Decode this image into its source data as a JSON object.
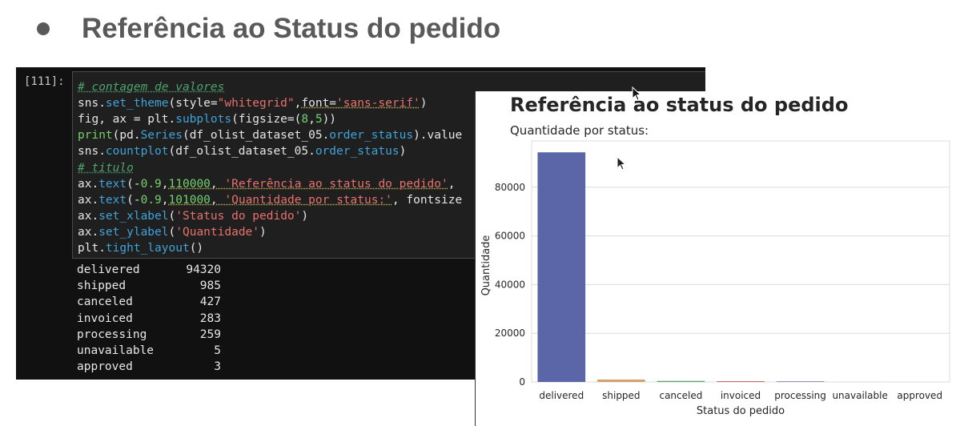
{
  "slide": {
    "title": "Referência ao Status do pedido"
  },
  "notebook": {
    "prompt": "[111]:",
    "code_lines": [
      [
        {
          "t": "# contagem de valores",
          "c": "cm"
        }
      ],
      [
        {
          "t": "sns."
        },
        {
          "t": "set_theme",
          "c": "fn"
        },
        {
          "t": "(style="
        },
        {
          "t": "\"whitegrid\"",
          "c": "st"
        },
        {
          "t": ","
        },
        {
          "t": "font=",
          "c": "ul"
        },
        {
          "t": "'sans-serif'",
          "c": "st ul"
        },
        {
          "t": ")"
        }
      ],
      [
        {
          "t": "fig, ax = plt."
        },
        {
          "t": "subplots",
          "c": "fn"
        },
        {
          "t": "(figsize=("
        },
        {
          "t": "8",
          "c": "nm"
        },
        {
          "t": ","
        },
        {
          "t": "5",
          "c": "nm"
        },
        {
          "t": "))"
        }
      ],
      [
        {
          "t": "print",
          "c": "nm"
        },
        {
          "t": "(pd."
        },
        {
          "t": "Series",
          "c": "fn"
        },
        {
          "t": "(df_olist_dataset_05."
        },
        {
          "t": "order_status",
          "c": "fn"
        },
        {
          "t": ").value"
        }
      ],
      [
        {
          "t": "sns."
        },
        {
          "t": "countplot",
          "c": "fn"
        },
        {
          "t": "(df_olist_dataset_05."
        },
        {
          "t": "order_status",
          "c": "fn"
        },
        {
          "t": ")"
        }
      ],
      [
        {
          "t": "# titulo",
          "c": "cm"
        }
      ],
      [
        {
          "t": "ax."
        },
        {
          "t": "text",
          "c": "fn"
        },
        {
          "t": "(-"
        },
        {
          "t": "0.9",
          "c": "nm"
        },
        {
          "t": ","
        },
        {
          "t": "110000",
          "c": "nm ul"
        },
        {
          "t": ", ",
          "c": "ul"
        },
        {
          "t": "'Referência ao status do pedido'",
          "c": "st ul"
        },
        {
          "t": ", "
        }
      ],
      [
        {
          "t": "ax."
        },
        {
          "t": "text",
          "c": "fn"
        },
        {
          "t": "(-"
        },
        {
          "t": "0.9",
          "c": "nm"
        },
        {
          "t": ","
        },
        {
          "t": "101000",
          "c": "nm ul"
        },
        {
          "t": ", ",
          "c": "ul"
        },
        {
          "t": "'Quantidade por status:'",
          "c": "st ul"
        },
        {
          "t": ", fontsize"
        }
      ],
      [
        {
          "t": "ax."
        },
        {
          "t": "set_xlabel",
          "c": "fn"
        },
        {
          "t": "("
        },
        {
          "t": "'Status do pedido'",
          "c": "st"
        },
        {
          "t": ")"
        }
      ],
      [
        {
          "t": "ax."
        },
        {
          "t": "set_ylabel",
          "c": "fn"
        },
        {
          "t": "("
        },
        {
          "t": "'Quantidade'",
          "c": "st"
        },
        {
          "t": ")"
        }
      ],
      [
        {
          "t": "plt."
        },
        {
          "t": "tight_layout",
          "c": "fn"
        },
        {
          "t": "()"
        }
      ]
    ],
    "output_rows": [
      {
        "label": "delivered",
        "value": "94320"
      },
      {
        "label": "shipped",
        "value": "985"
      },
      {
        "label": "canceled",
        "value": "427"
      },
      {
        "label": "invoiced",
        "value": "283"
      },
      {
        "label": "processing",
        "value": "259"
      },
      {
        "label": "unavailable",
        "value": "5"
      },
      {
        "label": "approved",
        "value": "3"
      }
    ]
  },
  "chart_data": {
    "type": "bar",
    "title": "Referência ao status do pedido",
    "subtitle": "Quantidade por status:",
    "xlabel": "Status do pedido",
    "ylabel": "Quantidade",
    "categories": [
      "delivered",
      "shipped",
      "canceled",
      "invoiced",
      "processing",
      "unavailable",
      "approved"
    ],
    "values": [
      94320,
      985,
      427,
      283,
      259,
      5,
      3
    ],
    "yticks": [
      0,
      20000,
      40000,
      60000,
      80000
    ],
    "ylim": [
      0,
      99000
    ],
    "grid": true,
    "colors": [
      "#5a66a8",
      "#d6a26b",
      "#59a86a",
      "#c44e52",
      "#8172b3",
      "#937860",
      "#da8bc3"
    ]
  },
  "icons": {
    "cursor_top": "mouse-pointer-icon",
    "cursor_chart": "mouse-pointer-icon"
  }
}
